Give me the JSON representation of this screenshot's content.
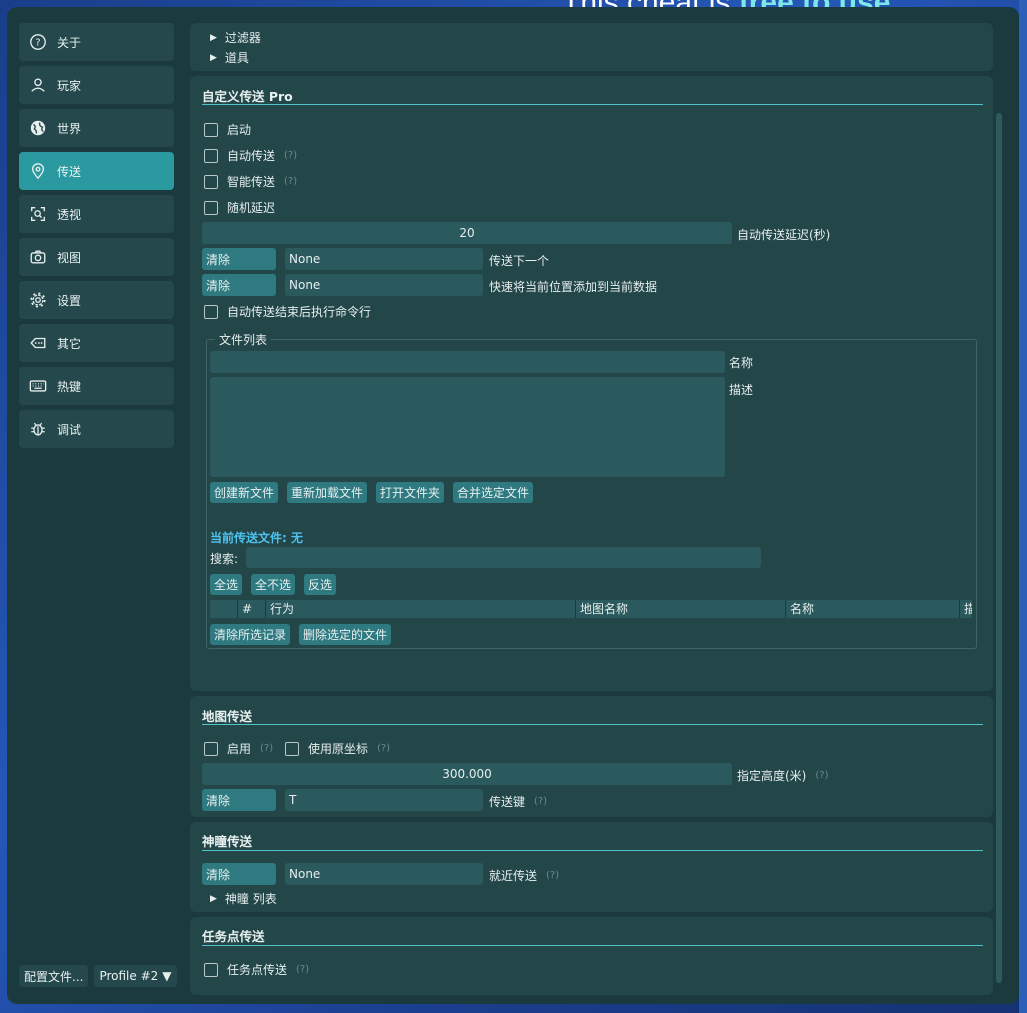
{
  "background": {
    "text_plain": "This cheat is ",
    "text_highlight": "free to use"
  },
  "sidebar": {
    "items": [
      {
        "label": "关于",
        "icon": "help-circle-icon"
      },
      {
        "label": "玩家",
        "icon": "user-icon"
      },
      {
        "label": "世界",
        "icon": "globe-icon"
      },
      {
        "label": "传送",
        "icon": "map-pin-icon",
        "active": true
      },
      {
        "label": "透视",
        "icon": "scan-icon"
      },
      {
        "label": "视图",
        "icon": "camera-icon"
      },
      {
        "label": "设置",
        "icon": "gear-icon"
      },
      {
        "label": "其它",
        "icon": "tag-icon"
      },
      {
        "label": "热键",
        "icon": "keyboard-icon"
      },
      {
        "label": "调试",
        "icon": "bug-icon"
      }
    ],
    "config_button": "配置文件...",
    "profile_select": "Profile #2"
  },
  "top_panel": {
    "filter": "过滤器",
    "items": "道具"
  },
  "custom_tp": {
    "title": "自定义传送 Pro",
    "enable": "启动",
    "auto_tp": "自动传送",
    "smart_tp": "智能传送",
    "random_delay": "随机延迟",
    "delay_value": "20",
    "delay_label": "自动传送延迟(秒)",
    "clear1": "清除",
    "key1": "None",
    "next_label": "传送下一个",
    "clear2": "清除",
    "key2": "None",
    "add_label": "快速将当前位置添加到当前数据",
    "exec_cmd": "自动传送结束后执行命令行",
    "help": "(?)",
    "file_list": {
      "title": "文件列表",
      "name_label": "名称",
      "desc_label": "描述",
      "create": "创建新文件",
      "reload": "重新加载文件",
      "open_folder": "打开文件夹",
      "merge": "合并选定文件",
      "current_file": "当前传送文件: 无",
      "search_label": "搜索:",
      "select_all": "全选",
      "select_none": "全不选",
      "invert": "反选",
      "columns": [
        "",
        "#",
        "行为",
        "地图名称",
        "名称",
        "描"
      ],
      "clear_records": "清除所选记录",
      "delete_files": "删除选定的文件"
    }
  },
  "map_tp": {
    "title": "地图传送",
    "enable": "启用",
    "use_raw": "使用原坐标",
    "height_value": "300.000",
    "height_label": "指定高度(米)",
    "clear": "清除",
    "key": "T",
    "key_label": "传送键"
  },
  "oculi_tp": {
    "title": "神瞳传送",
    "clear": "清除",
    "key": "None",
    "nearby": "就近传送",
    "list": "神瞳 列表"
  },
  "quest_tp": {
    "title": "任务点传送",
    "toggle": "任务点传送"
  }
}
